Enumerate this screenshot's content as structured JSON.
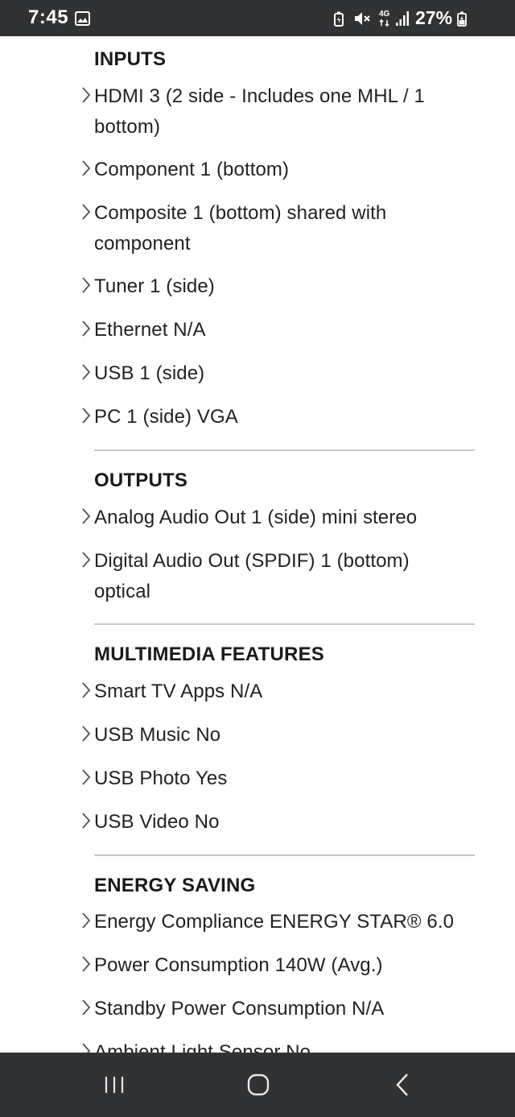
{
  "status_bar": {
    "time": "7:45",
    "battery_percent": "27%",
    "network_label": "4G",
    "icons": [
      "gallery-icon",
      "battery-saver-icon",
      "mute-icon",
      "network-4g-icon",
      "signal-icon",
      "battery-charging-icon"
    ]
  },
  "sections": [
    {
      "heading": "INPUTS",
      "items": [
        "HDMI 3 (2 side - Includes one MHL / 1 bottom)",
        "Component 1 (bottom)",
        "Composite 1 (bottom) shared with component",
        "Tuner 1 (side)",
        "Ethernet N/A",
        "USB 1 (side)",
        "PC 1 (side) VGA"
      ]
    },
    {
      "heading": "OUTPUTS",
      "items": [
        "Analog Audio Out 1 (side) mini stereo",
        "Digital Audio Out (SPDIF) 1 (bottom) optical"
      ]
    },
    {
      "heading": "MULTIMEDIA FEATURES",
      "items": [
        "Smart TV Apps N/A",
        "USB Music No",
        "USB Photo Yes",
        "USB Video No"
      ]
    },
    {
      "heading": "ENERGY SAVING",
      "items": [
        "Energy Compliance ENERGY STAR® 6.0",
        "Power Consumption 140W (Avg.)",
        "Standby Power Consumption N/A",
        "Ambient Light Sensor No"
      ]
    }
  ],
  "nav_bar": {
    "buttons": [
      "recents-button",
      "home-button",
      "back-button"
    ]
  },
  "colors": {
    "bars": "#303234",
    "text": "#222222",
    "heading": "#1a1a1a",
    "divider": "#c8c8c8",
    "chevron": "#555555"
  }
}
